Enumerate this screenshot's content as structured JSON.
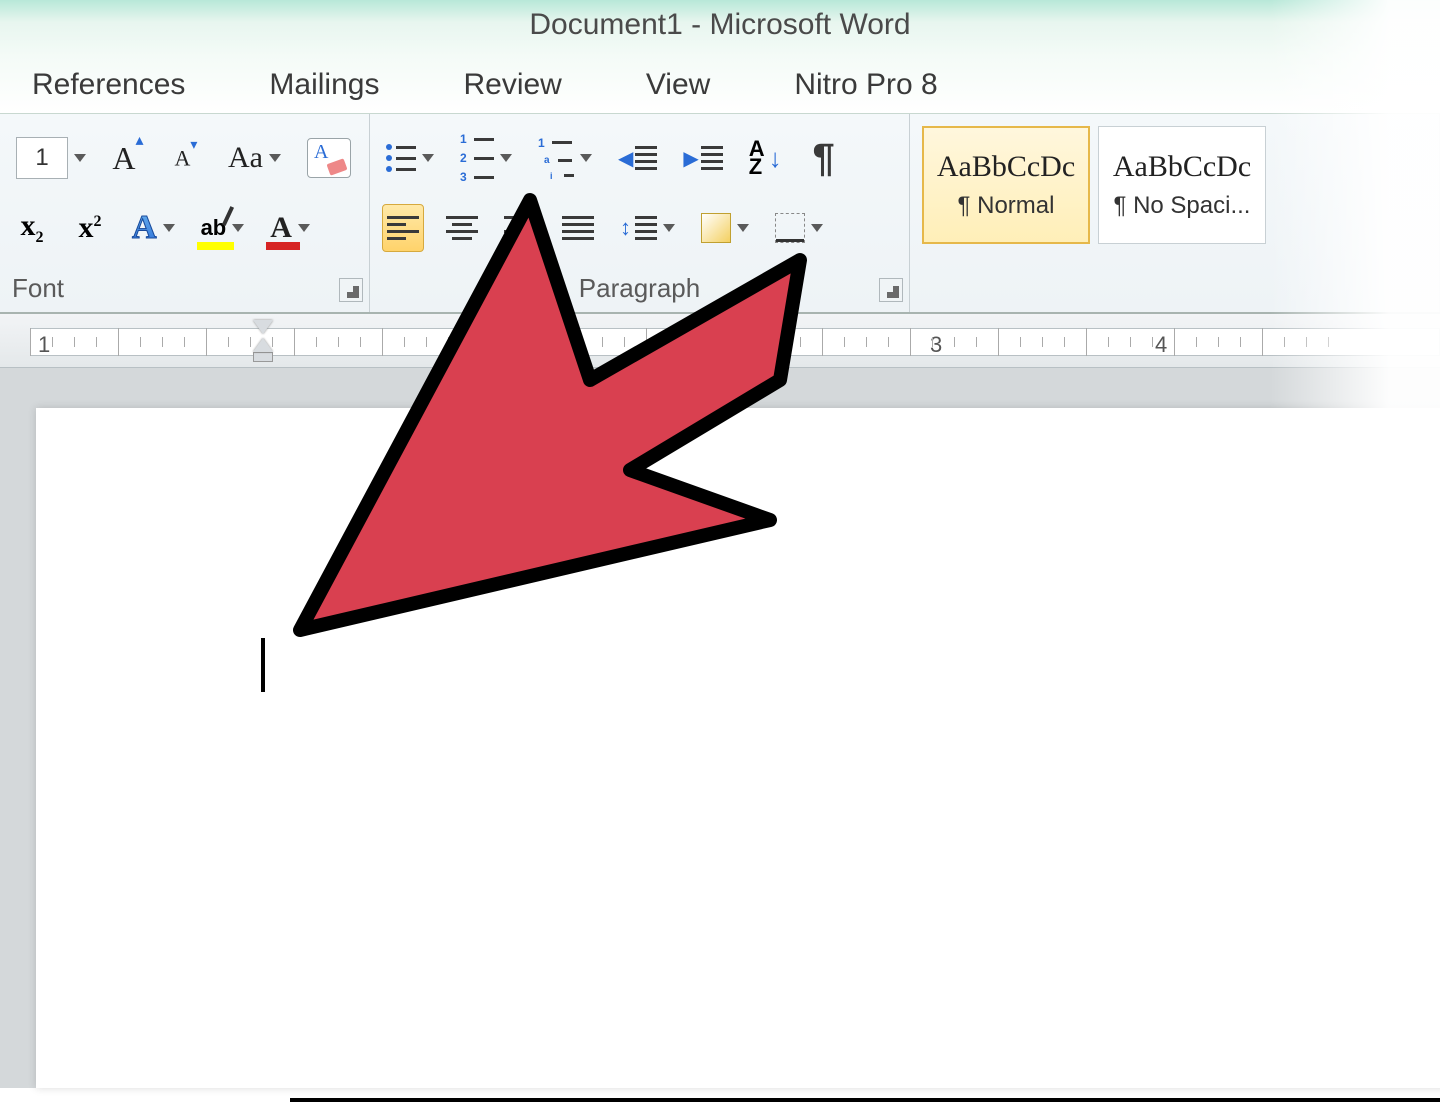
{
  "title": "Document1 - Microsoft Word",
  "tabs": [
    "References",
    "Mailings",
    "Review",
    "View",
    "Nitro Pro 8"
  ],
  "font_group": {
    "label": "Font",
    "size_value": "1"
  },
  "paragraph_group": {
    "label": "Paragraph"
  },
  "styles": [
    {
      "sample": "AaBbCcDc",
      "name": "¶ Normal",
      "selected": true
    },
    {
      "sample": "AaBbCcDc",
      "name": "¶ No Spaci...",
      "selected": false
    }
  ],
  "ruler": {
    "numbers": [
      "1",
      "3",
      "4"
    ]
  }
}
